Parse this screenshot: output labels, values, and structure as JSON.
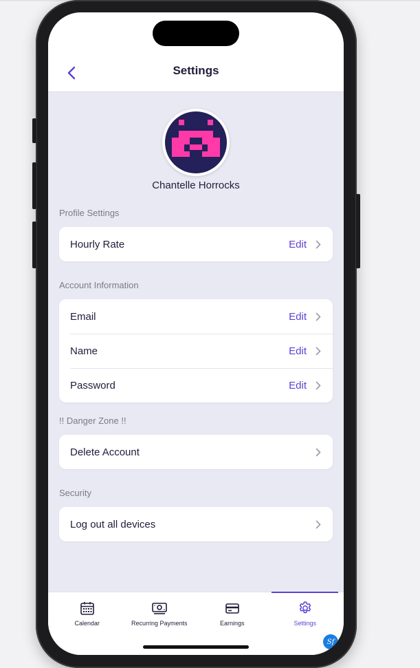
{
  "header": {
    "title": "Settings"
  },
  "profile": {
    "name": "Chantelle Horrocks"
  },
  "sections": [
    {
      "label": "Profile Settings",
      "rows": [
        {
          "label": "Hourly Rate",
          "action": "Edit"
        }
      ]
    },
    {
      "label": "Account Information",
      "rows": [
        {
          "label": "Email",
          "action": "Edit"
        },
        {
          "label": "Name",
          "action": "Edit"
        },
        {
          "label": "Password",
          "action": "Edit"
        }
      ]
    },
    {
      "label": "!! Danger Zone !!",
      "rows": [
        {
          "label": "Delete Account",
          "action": ""
        }
      ]
    },
    {
      "label": "Security",
      "rows": [
        {
          "label": "Log out all devices",
          "action": ""
        }
      ]
    }
  ],
  "tabs": [
    {
      "label": "Calendar",
      "icon": "calendar-icon"
    },
    {
      "label": "Recurring Payments",
      "icon": "money-icon"
    },
    {
      "label": "Earnings",
      "icon": "card-icon"
    },
    {
      "label": "Settings",
      "icon": "gear-icon",
      "active": true
    }
  ],
  "badge_text": "Sf",
  "colors": {
    "accent": "#5d3fd3",
    "background": "#e9e9f3",
    "avatar_bg": "#24205a",
    "avatar_fg": "#ff3aa8"
  }
}
